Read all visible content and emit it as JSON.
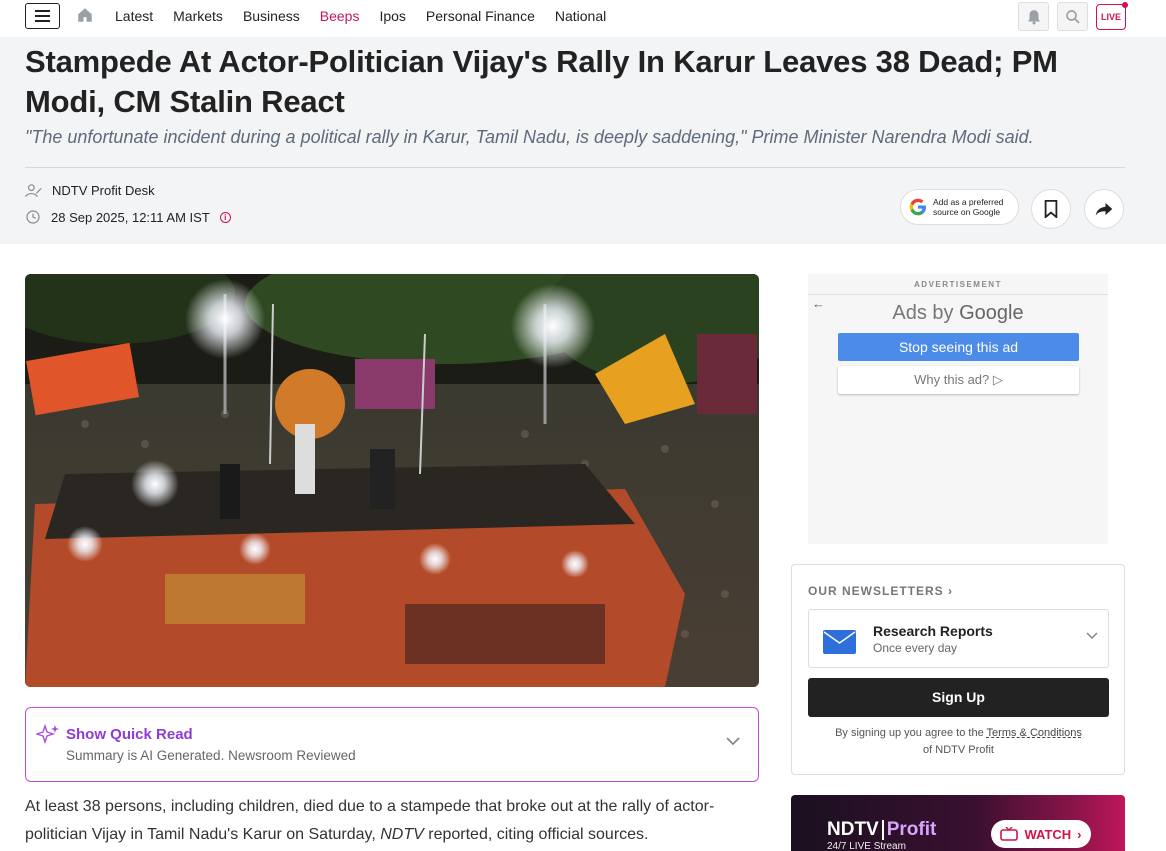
{
  "nav": {
    "links": [
      "Latest",
      "Markets",
      "Business",
      "Beeps",
      "Ipos",
      "Personal Finance",
      "National"
    ],
    "active_link": "Beeps",
    "live_label": "LIVE"
  },
  "article": {
    "headline": "Stampede At Actor-Politician Vijay's Rally In Karur Leaves 38 Dead; PM Modi, CM Stalin React",
    "subhead": "\"The unfortunate incident during a political rally in Karur, Tamil Nadu, is deeply saddening,\" Prime Minister Narendra Modi said.",
    "author": "NDTV Profit Desk",
    "date": "28 Sep 2025, 12:11 AM IST",
    "info_icon": "i",
    "google_pref_line1": "Add as a preferred",
    "google_pref_line2": "source on Google",
    "body_p1_a": "At least 38 persons, including children, died due to a stampede that broke out at the rally of actor-politician Vijay in Tamil Nadu's Karur on Saturday, ",
    "body_p1_em": "NDTV",
    "body_p1_b": " reported, citing official sources."
  },
  "quick_read": {
    "title": "Show Quick Read",
    "subtitle": "Summary is AI Generated. Newsroom Reviewed"
  },
  "ad": {
    "label": "ADVERTISEMENT",
    "ads_by": "Ads by",
    "google": "Google",
    "stop_label": "Stop seeing this ad",
    "why_label": "Why this ad? ▷"
  },
  "newsletter": {
    "heading": "OUR NEWSLETTERS",
    "item_title": "Research Reports",
    "item_freq": "Once every day",
    "signup_label": "Sign Up",
    "terms_prefix": "By signing up you agree to the ",
    "terms_link": "Terms & Conditions",
    "terms_suffix": "of NDTV Profit"
  },
  "watch": {
    "brand": "NDTV",
    "brand2": "Profit",
    "stream_label": "24/7 LIVE Stream",
    "button_label": "WATCH"
  },
  "colors": {
    "accent": "#c2185b",
    "quick_read": "#8e3cd9",
    "ad_button": "#4c8be8"
  }
}
